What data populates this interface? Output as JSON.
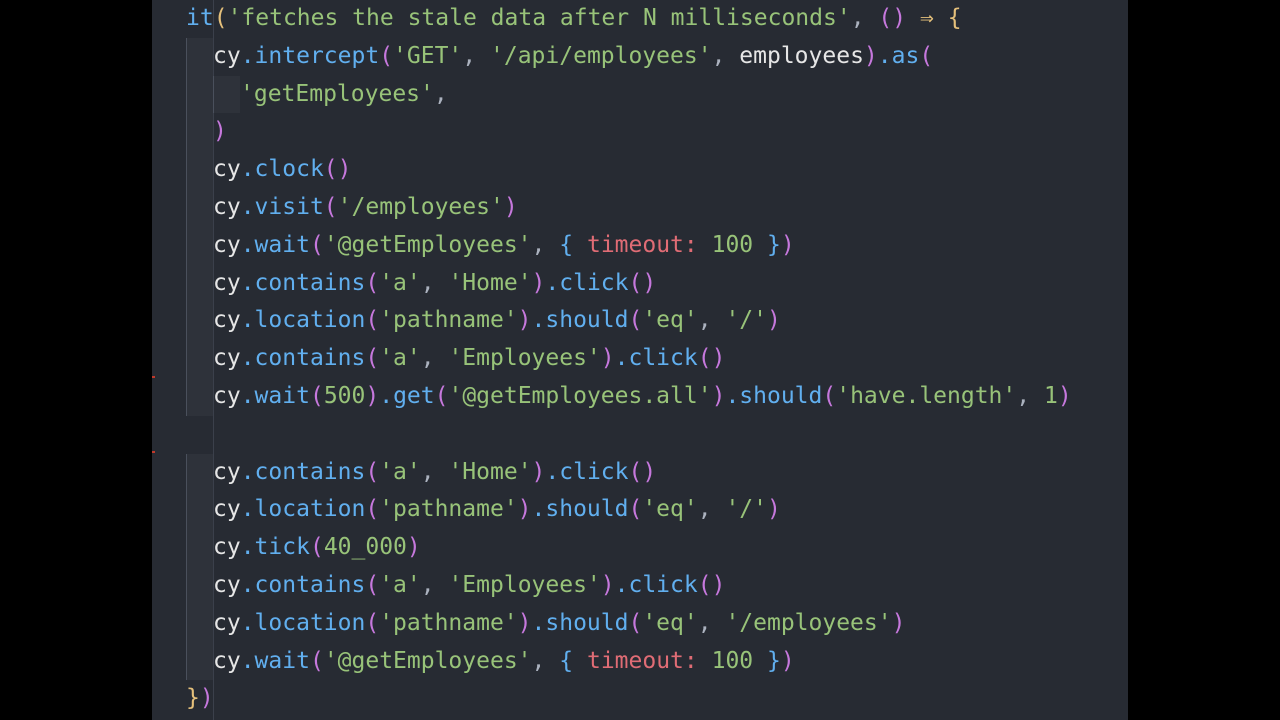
{
  "editor": {
    "background": "#272b33",
    "colors": {
      "function": "#61afef",
      "string": "#98c379",
      "identifier": "#e6e6e6",
      "property": "#e06c75",
      "bracket_level_1": "#e5c07b",
      "bracket_level_2": "#c678dd",
      "bracket_level_3": "#61afef"
    },
    "lines": [
      {
        "indent": 0,
        "tokens": [
          [
            "fn",
            "it"
          ],
          [
            "b1",
            "("
          ],
          [
            "str",
            "'fetches the stale data after N milliseconds'"
          ],
          [
            "punc",
            ","
          ],
          [
            "ws",
            " "
          ],
          [
            "b2",
            "()"
          ],
          [
            "ws",
            " "
          ],
          [
            "op",
            "⇒"
          ],
          [
            "ws",
            " "
          ],
          [
            "b1",
            "{"
          ]
        ]
      },
      {
        "indent": 1,
        "tokens": [
          [
            "id",
            "cy"
          ],
          [
            "fn",
            ".intercept"
          ],
          [
            "b2",
            "("
          ],
          [
            "str",
            "'GET'"
          ],
          [
            "punc",
            ","
          ],
          [
            "ws",
            " "
          ],
          [
            "str",
            "'/api/employees'"
          ],
          [
            "punc",
            ","
          ],
          [
            "ws",
            " "
          ],
          [
            "id",
            "employees"
          ],
          [
            "b2",
            ")"
          ],
          [
            "fn",
            ".as"
          ],
          [
            "b2",
            "("
          ]
        ]
      },
      {
        "indent": 2,
        "tokens": [
          [
            "str",
            "'getEmployees'"
          ],
          [
            "punc",
            ","
          ]
        ]
      },
      {
        "indent": 1,
        "tokens": [
          [
            "b2",
            ")"
          ]
        ]
      },
      {
        "indent": 1,
        "tokens": [
          [
            "id",
            "cy"
          ],
          [
            "fn",
            ".clock"
          ],
          [
            "b2",
            "()"
          ]
        ]
      },
      {
        "indent": 1,
        "tokens": [
          [
            "id",
            "cy"
          ],
          [
            "fn",
            ".visit"
          ],
          [
            "b2",
            "("
          ],
          [
            "str",
            "'/employees'"
          ],
          [
            "b2",
            ")"
          ]
        ]
      },
      {
        "indent": 1,
        "tokens": [
          [
            "id",
            "cy"
          ],
          [
            "fn",
            ".wait"
          ],
          [
            "b2",
            "("
          ],
          [
            "str",
            "'@getEmployees'"
          ],
          [
            "punc",
            ","
          ],
          [
            "ws",
            " "
          ],
          [
            "b3",
            "{"
          ],
          [
            "ws",
            " "
          ],
          [
            "prop",
            "timeout:"
          ],
          [
            "ws",
            " "
          ],
          [
            "num",
            "100"
          ],
          [
            "ws",
            " "
          ],
          [
            "b3",
            "}"
          ],
          [
            "b2",
            ")"
          ]
        ]
      },
      {
        "indent": 1,
        "tokens": [
          [
            "id",
            "cy"
          ],
          [
            "fn",
            ".contains"
          ],
          [
            "b2",
            "("
          ],
          [
            "str",
            "'a'"
          ],
          [
            "punc",
            ","
          ],
          [
            "ws",
            " "
          ],
          [
            "str",
            "'Home'"
          ],
          [
            "b2",
            ")"
          ],
          [
            "fn",
            ".click"
          ],
          [
            "b2",
            "()"
          ]
        ]
      },
      {
        "indent": 1,
        "tokens": [
          [
            "id",
            "cy"
          ],
          [
            "fn",
            ".location"
          ],
          [
            "b2",
            "("
          ],
          [
            "str",
            "'pathname'"
          ],
          [
            "b2",
            ")"
          ],
          [
            "fn",
            ".should"
          ],
          [
            "b2",
            "("
          ],
          [
            "str",
            "'eq'"
          ],
          [
            "punc",
            ","
          ],
          [
            "ws",
            " "
          ],
          [
            "str",
            "'/'"
          ],
          [
            "b2",
            ")"
          ]
        ]
      },
      {
        "indent": 1,
        "tokens": [
          [
            "id",
            "cy"
          ],
          [
            "fn",
            ".contains"
          ],
          [
            "b2",
            "("
          ],
          [
            "str",
            "'a'"
          ],
          [
            "punc",
            ","
          ],
          [
            "ws",
            " "
          ],
          [
            "str",
            "'Employees'"
          ],
          [
            "b2",
            ")"
          ],
          [
            "fn",
            ".click"
          ],
          [
            "b2",
            "()"
          ]
        ]
      },
      {
        "indent": 1,
        "tokens": [
          [
            "id",
            "cy"
          ],
          [
            "fn",
            ".wait"
          ],
          [
            "b2",
            "("
          ],
          [
            "num",
            "500"
          ],
          [
            "b2",
            ")"
          ],
          [
            "fn",
            ".get"
          ],
          [
            "b2",
            "("
          ],
          [
            "str",
            "'@getEmployees.all'"
          ],
          [
            "b2",
            ")"
          ],
          [
            "fn",
            ".should"
          ],
          [
            "b2",
            "("
          ],
          [
            "str",
            "'have.length'"
          ],
          [
            "punc",
            ","
          ],
          [
            "ws",
            " "
          ],
          [
            "num",
            "1"
          ],
          [
            "b2",
            ")"
          ]
        ]
      },
      {
        "indent": 0,
        "tokens": []
      },
      {
        "indent": 1,
        "tokens": [
          [
            "id",
            "cy"
          ],
          [
            "fn",
            ".contains"
          ],
          [
            "b2",
            "("
          ],
          [
            "str",
            "'a'"
          ],
          [
            "punc",
            ","
          ],
          [
            "ws",
            " "
          ],
          [
            "str",
            "'Home'"
          ],
          [
            "b2",
            ")"
          ],
          [
            "fn",
            ".click"
          ],
          [
            "b2",
            "()"
          ]
        ]
      },
      {
        "indent": 1,
        "tokens": [
          [
            "id",
            "cy"
          ],
          [
            "fn",
            ".location"
          ],
          [
            "b2",
            "("
          ],
          [
            "str",
            "'pathname'"
          ],
          [
            "b2",
            ")"
          ],
          [
            "fn",
            ".should"
          ],
          [
            "b2",
            "("
          ],
          [
            "str",
            "'eq'"
          ],
          [
            "punc",
            ","
          ],
          [
            "ws",
            " "
          ],
          [
            "str",
            "'/'"
          ],
          [
            "b2",
            ")"
          ]
        ]
      },
      {
        "indent": 1,
        "tokens": [
          [
            "id",
            "cy"
          ],
          [
            "fn",
            ".tick"
          ],
          [
            "b2",
            "("
          ],
          [
            "num",
            "40_000"
          ],
          [
            "b2",
            ")"
          ]
        ]
      },
      {
        "indent": 1,
        "tokens": [
          [
            "id",
            "cy"
          ],
          [
            "fn",
            ".contains"
          ],
          [
            "b2",
            "("
          ],
          [
            "str",
            "'a'"
          ],
          [
            "punc",
            ","
          ],
          [
            "ws",
            " "
          ],
          [
            "str",
            "'Employees'"
          ],
          [
            "b2",
            ")"
          ],
          [
            "fn",
            ".click"
          ],
          [
            "b2",
            "()"
          ]
        ]
      },
      {
        "indent": 1,
        "tokens": [
          [
            "id",
            "cy"
          ],
          [
            "fn",
            ".location"
          ],
          [
            "b2",
            "("
          ],
          [
            "str",
            "'pathname'"
          ],
          [
            "b2",
            ")"
          ],
          [
            "fn",
            ".should"
          ],
          [
            "b2",
            "("
          ],
          [
            "str",
            "'eq'"
          ],
          [
            "punc",
            ","
          ],
          [
            "ws",
            " "
          ],
          [
            "str",
            "'/employees'"
          ],
          [
            "b2",
            ")"
          ]
        ]
      },
      {
        "indent": 1,
        "tokens": [
          [
            "id",
            "cy"
          ],
          [
            "fn",
            ".wait"
          ],
          [
            "b2",
            "("
          ],
          [
            "str",
            "'@getEmployees'"
          ],
          [
            "punc",
            ","
          ],
          [
            "ws",
            " "
          ],
          [
            "b3",
            "{"
          ],
          [
            "ws",
            " "
          ],
          [
            "prop",
            "timeout:"
          ],
          [
            "ws",
            " "
          ],
          [
            "num",
            "100"
          ],
          [
            "ws",
            " "
          ],
          [
            "b3",
            "}"
          ],
          [
            "b2",
            ")"
          ]
        ]
      },
      {
        "indent": 0,
        "tokens": [
          [
            "b1",
            "}"
          ],
          [
            "b2",
            ")"
          ]
        ]
      }
    ]
  }
}
